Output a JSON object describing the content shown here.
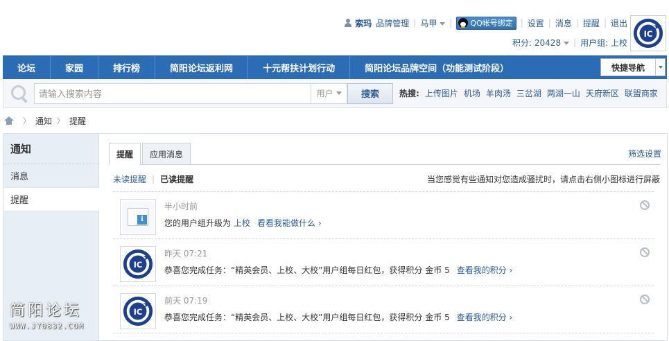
{
  "userbar": {
    "username": "索玛",
    "brand_manage": "品牌管理",
    "account_menu": "马甲",
    "qq_bind": "QQ帐号绑定",
    "settings": "设置",
    "messages": "消息",
    "reminders": "提醒",
    "logout": "退出",
    "points_label": "积分: 20428",
    "usergroup_label": "用户组: 上校"
  },
  "nav": {
    "items": [
      "论坛",
      "家园",
      "排行榜",
      "简阳论坛返利网",
      "十元帮扶计划行动",
      "简阳论坛品牌空间（功能测试阶段）"
    ],
    "quick_nav": "快捷导航"
  },
  "search": {
    "placeholder": "请输入搜索内容",
    "type": "用户",
    "button": "搜索",
    "hot_label": "热搜:",
    "hot": [
      "上传图片",
      "机场",
      "羊肉汤",
      "三岔湖",
      "两湖一山",
      "天府新区",
      "联盟商家"
    ]
  },
  "breadcrumb": [
    "通知",
    "提醒"
  ],
  "sidebar": {
    "title": "通知",
    "items": [
      "消息",
      "提醒"
    ]
  },
  "tabs": [
    "提醒",
    "应用消息"
  ],
  "filter_settings": "筛选设置",
  "subtabs": {
    "unread": "未读提醒",
    "read": "已读提醒"
  },
  "tip": "当您感觉有些通知对您造成骚扰时，请点击右侧小图标进行屏蔽",
  "notices": [
    {
      "time": "半小时前",
      "text": "您的用户组升级为",
      "link": "上校",
      "more": "看看我能做什么 ›"
    },
    {
      "time": "昨天 07:21",
      "text": "恭喜您完成任务：“精英会员、上校、大校”用户组每日红包，获得积分 金币 5",
      "more": "查看我的积分 ›"
    },
    {
      "time": "前天 07:19",
      "text": "恭喜您完成任务：“精英会员、上校、大校”用户组每日红包，获得积分 金币 5",
      "more": "查看我的积分 ›"
    }
  ],
  "watermark": {
    "line1": "简阳论坛",
    "line2": "WWW.JY0832.COM"
  }
}
